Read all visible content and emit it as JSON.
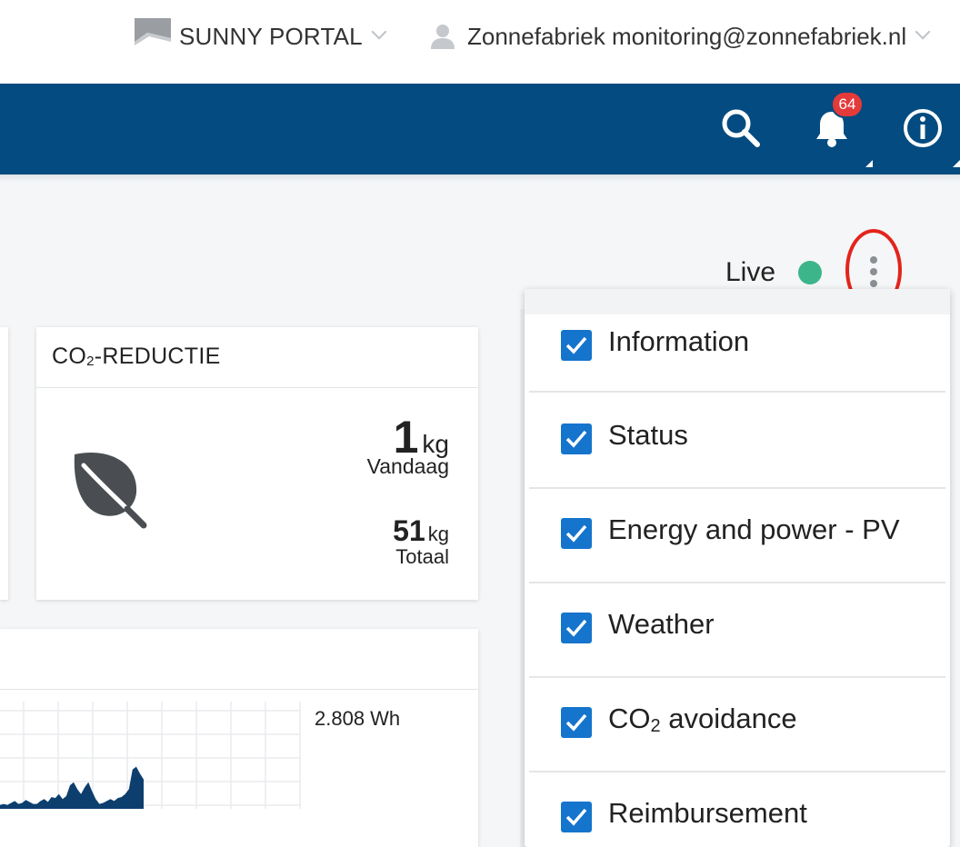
{
  "header": {
    "portal_label": "SUNNY PORTAL",
    "user_label": "Zonnefabriek monitoring@zonnefabriek.nl"
  },
  "nav": {
    "notification_count": "64"
  },
  "status": {
    "live_label": "Live",
    "live_color": "#3db58a"
  },
  "co2_card": {
    "title_prefix": "CO",
    "title_sub": "2",
    "title_suffix": "-REDUCTIE",
    "today_value": "1",
    "today_unit": "kg",
    "today_label": "Vandaag",
    "total_value": "51",
    "total_unit": "kg",
    "total_label": "Totaal"
  },
  "chart_card": {
    "max_label": "2.808 Wh"
  },
  "chart_data": {
    "type": "area",
    "color": "#0d3f6e",
    "x": [
      0,
      1,
      2,
      3,
      4,
      5,
      6,
      7,
      8,
      9,
      10,
      11,
      12,
      13,
      14,
      15,
      16,
      17,
      18,
      19,
      20,
      21,
      22,
      23,
      24,
      25,
      26,
      27,
      28,
      29,
      30,
      31,
      32,
      33,
      34,
      35,
      36,
      37,
      38,
      39,
      40,
      41,
      42,
      43,
      44,
      45,
      46,
      47
    ],
    "values": [
      0.04,
      0.05,
      0.04,
      0.06,
      0.08,
      0.05,
      0.06,
      0.09,
      0.07,
      0.05,
      0.05,
      0.08,
      0.1,
      0.07,
      0.12,
      0.11,
      0.15,
      0.1,
      0.13,
      0.24,
      0.27,
      0.2,
      0.15,
      0.22,
      0.27,
      0.18,
      0.1,
      0.05,
      0.06,
      0.08,
      0.1,
      0.08,
      0.11,
      0.12,
      0.15,
      0.2,
      0.4,
      0.43,
      0.36,
      0.3
    ],
    "ylim": [
      0,
      1
    ]
  },
  "menu": {
    "items": [
      {
        "label": "Information",
        "checked": true
      },
      {
        "label": "Status",
        "checked": true
      },
      {
        "label": "Energy and power - PV",
        "checked": true
      },
      {
        "label": "Weather",
        "checked": true
      },
      {
        "label_prefix": "CO",
        "label_sub": "2",
        "label_suffix": " avoidance",
        "checked": true
      },
      {
        "label": "Reimbursement",
        "checked": true
      }
    ]
  },
  "icons": {
    "brand": "sunny-portal-logo",
    "user": "user-icon",
    "search": "search-icon",
    "bell": "bell-icon",
    "info": "info-icon",
    "kebab": "kebab-menu-icon",
    "leaf": "leaf-icon",
    "checkbox": "checkbox-checked-icon"
  },
  "colors": {
    "nav_bg": "#034b80",
    "badge": "#e53a3a",
    "checkbox": "#1574cc",
    "highlight_ring": "#e3241c"
  }
}
